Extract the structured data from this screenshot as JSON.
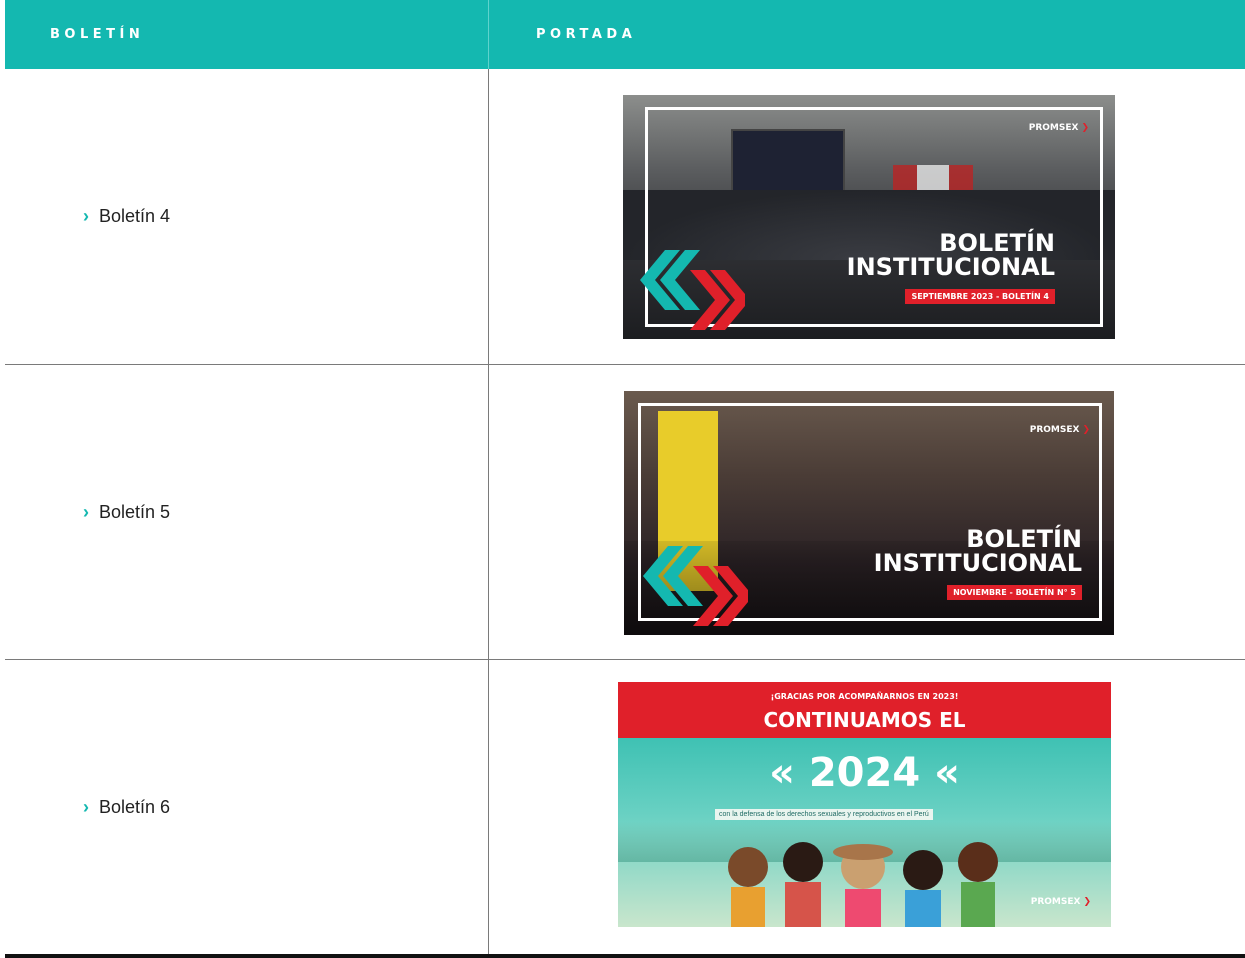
{
  "header": {
    "col1": "BOLETÍN",
    "col2": "PORTADA"
  },
  "colors": {
    "accent": "#14b8b0",
    "red": "#e0202a"
  },
  "rows": [
    {
      "label": "Boletín 4",
      "cover": {
        "title_line1": "BOLETÍN",
        "title_line2": "INSTITUCIONAL",
        "subtitle": "SEPTIEMBRE 2023 - BOLETÍN 4",
        "logo": "PROMSEX"
      }
    },
    {
      "label": "Boletín 5",
      "cover": {
        "title_line1": "BOLETÍN",
        "title_line2": "INSTITUCIONAL",
        "subtitle": "NOVIEMBRE - BOLETÍN N° 5",
        "logo": "PROMSEX"
      }
    },
    {
      "label": "Boletín 6",
      "cover": {
        "top_text": "¡GRACIAS POR ACOMPAÑARNOS EN 2023!",
        "headline": "CONTINUAMOS EL",
        "year": "« 2024 «",
        "caption": "con la defensa de los derechos sexuales y reproductivos en el Perú",
        "logo": "PROMSEX"
      }
    }
  ]
}
